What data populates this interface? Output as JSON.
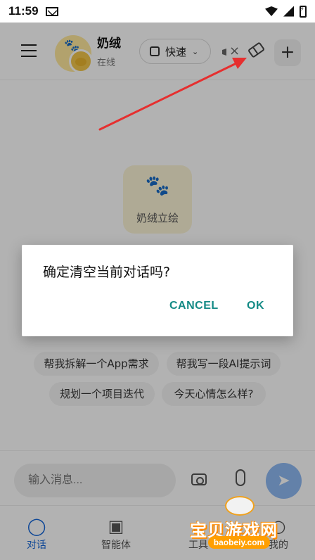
{
  "status_bar": {
    "time": "11:59"
  },
  "header": {
    "character_name": "奶绒",
    "status": "在线",
    "mode_label": "快速"
  },
  "main": {
    "portrait_label": "奶绒立绘",
    "suggestions": [
      "帮我拆解一个App需求",
      "帮我写一段AI提示词",
      "规划一个项目迭代",
      "今天心情怎么样?"
    ]
  },
  "composer": {
    "placeholder": "输入消息..."
  },
  "bottom_nav": {
    "items": [
      {
        "label": "对话"
      },
      {
        "label": "智能体"
      },
      {
        "label": "工具"
      },
      {
        "label": "我的"
      }
    ]
  },
  "dialog": {
    "title": "确定清空当前对话吗?",
    "cancel_label": "CANCEL",
    "ok_label": "OK"
  },
  "watermark": {
    "text": "宝贝游戏网",
    "domain": "baobeiy.com"
  },
  "colors": {
    "dialog_action": "#138a85",
    "active_tab": "#1667d9",
    "arrow": "#e62f2f"
  }
}
